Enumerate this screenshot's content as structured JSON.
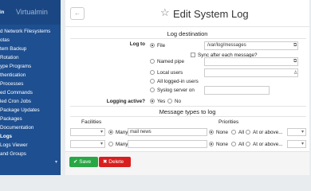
{
  "sidebar": {
    "logo": "Virtualmin",
    "top_item": "in",
    "items": [
      {
        "label": "d Network Filesystems",
        "active": false
      },
      {
        "label": "otas",
        "active": false
      },
      {
        "label": "tem Backup",
        "active": false
      },
      {
        "label": "Rotation",
        "active": false
      },
      {
        "label": "ype Programs",
        "active": false
      },
      {
        "label": "thentication",
        "active": false
      },
      {
        "label": "Processes",
        "active": false
      },
      {
        "label": "ed Commands",
        "active": false
      },
      {
        "label": "led Cron Jobs",
        "active": false
      },
      {
        "label": "Package Updates",
        "active": false
      },
      {
        "label": "Packages",
        "active": false
      },
      {
        "label": "Documentation",
        "active": false
      },
      {
        "label": "Logs",
        "active": true
      },
      {
        "label": "Logs Viewer",
        "active": false
      },
      {
        "label": "and Groups",
        "active": false
      },
      {
        "label": "",
        "active": false
      }
    ]
  },
  "header": {
    "back": "←",
    "star": "☆",
    "title": "Edit System Log"
  },
  "destination": {
    "title": "Log destination",
    "log_to_label": "Log to",
    "file_label": "File",
    "file_value": "/var/log/messages",
    "sync_label": "Sync after each message?",
    "named_pipe_label": "Named pipe",
    "local_users_label": "Local users",
    "all_users_label": "All logged-in users",
    "syslog_server_label": "Syslog server on",
    "logging_active_label": "Logging active?",
    "yes_label": "Yes",
    "no_label": "No"
  },
  "message_types": {
    "title": "Message types to log",
    "facilities_header": "Facilities",
    "priorities_header": "Priorities",
    "rows": [
      {
        "many_label": "Many",
        "many_value": "mail news",
        "none_label": "None",
        "all_label": "All",
        "at_or_above": "At or above..."
      },
      {
        "many_label": "Many",
        "many_value": "",
        "none_label": "None",
        "all_label": "All",
        "at_or_above": "At or above..."
      }
    ]
  },
  "buttons": {
    "save": "Save",
    "delete": "Delete"
  },
  "colors": {
    "sidebar": "#1d4f91",
    "save": "#28a745",
    "delete": "#d81f1f"
  }
}
